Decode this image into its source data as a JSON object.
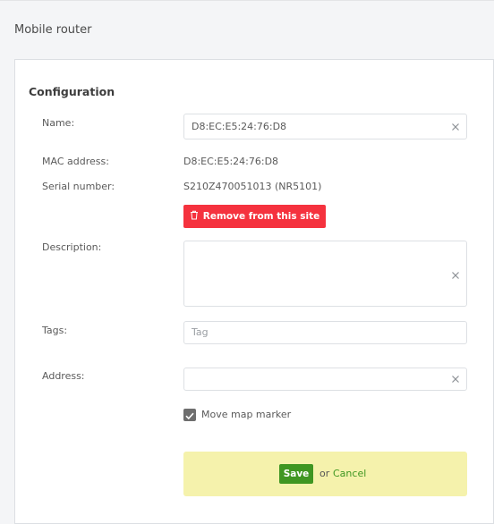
{
  "page": {
    "title": "Mobile router"
  },
  "configuration": {
    "heading": "Configuration",
    "name_label": "Name:",
    "name_value": "D8:EC:E5:24:76:D8",
    "mac_label": "MAC address:",
    "mac_value": "D8:EC:E5:24:76:D8",
    "serial_label": "Serial number:",
    "serial_value": "S210Z47005101​3 (NR5101)",
    "remove_label": "Remove from this site",
    "description_label": "Description:",
    "description_value": "",
    "tags_label": "Tags:",
    "tags_placeholder": "Tag",
    "address_label": "Address:",
    "address_value": "",
    "move_marker_label": "Move map marker",
    "move_marker_checked": true
  },
  "actions": {
    "save_label": "Save",
    "or_text": "or",
    "cancel_label": "Cancel"
  },
  "colors": {
    "remove_button": "#f5323e",
    "save_button": "#3f9622",
    "save_panel": "#f5f2ac",
    "checkbox": "#6e6e6e"
  }
}
